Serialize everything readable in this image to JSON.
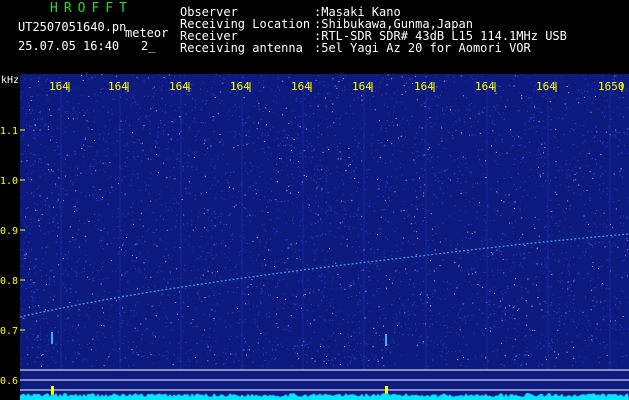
{
  "header": {
    "app_title": "HROFFT",
    "filename": "UT2507051640.pn",
    "meteor_label": "meteor",
    "timestamp": "25.07.05 16:40",
    "frame_index": "2_"
  },
  "station_info": [
    {
      "label": "Observer",
      "value": ":Masaki Kano"
    },
    {
      "label": "Receiving Location",
      "value": ":Shibukawa,Gunma,Japan"
    },
    {
      "label": "Receiver",
      "value": ":RTL-SDR SDR# 43dB L15 114.1MHz USB"
    },
    {
      "label": "Receiving antenna",
      "value": ":5el Yagi Az 20 for Aomori VOR"
    }
  ],
  "spectrogram": {
    "y_unit": "kHz",
    "y_ticks": [
      "1.1",
      "1.0",
      "0.9",
      "0.8",
      "0.7",
      "0.6"
    ],
    "top_freq_labels": [
      "164",
      "164",
      "164",
      "164",
      "164",
      "164",
      "164",
      "164",
      "164",
      "1650"
    ],
    "colors": {
      "background": "#0d1a80",
      "noise": "#3a5cff",
      "trace": "#4fb7ff",
      "grid": "#ffff00",
      "baseline": "#00e5ff",
      "hline": "#ffffff"
    }
  }
}
